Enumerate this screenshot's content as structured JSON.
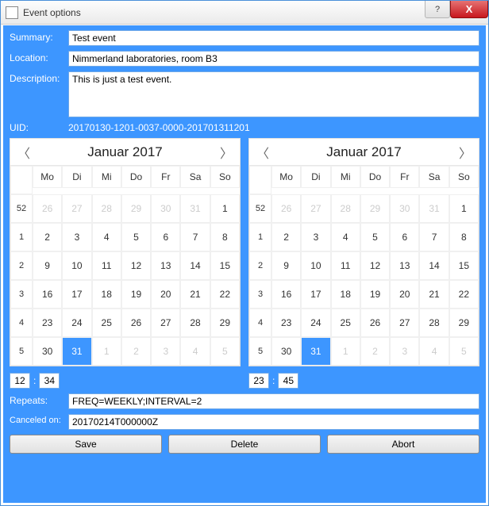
{
  "window": {
    "title": "Event options",
    "help": "?",
    "close": "X"
  },
  "form": {
    "summary_label": "Summary:",
    "summary_value": "Test event",
    "location_label": "Location:",
    "location_value": "Nimmerland laboratories, room B3",
    "description_label": "Description:",
    "description_value": "This is just a test event.",
    "uid_label": "UID:",
    "uid_value": "20170130-1201-0037-0000-201701311201",
    "repeats_label": "Repeats:",
    "repeats_value": "FREQ=WEEKLY;INTERVAL=2",
    "canceled_label": "Canceled on:",
    "canceled_value": "20170214T000000Z"
  },
  "calendar_left": {
    "title": "Januar 2017",
    "dow": [
      "Mo",
      "Di",
      "Mi",
      "Do",
      "Fr",
      "Sa",
      "So"
    ],
    "weeks": [
      {
        "wk": "52",
        "days": [
          {
            "d": "26",
            "other": true
          },
          {
            "d": "27",
            "other": true
          },
          {
            "d": "28",
            "other": true
          },
          {
            "d": "29",
            "other": true
          },
          {
            "d": "30",
            "other": true
          },
          {
            "d": "31",
            "other": true
          },
          {
            "d": "1"
          }
        ]
      },
      {
        "wk": "1",
        "days": [
          {
            "d": "2"
          },
          {
            "d": "3"
          },
          {
            "d": "4"
          },
          {
            "d": "5"
          },
          {
            "d": "6"
          },
          {
            "d": "7"
          },
          {
            "d": "8"
          }
        ]
      },
      {
        "wk": "2",
        "days": [
          {
            "d": "9"
          },
          {
            "d": "10"
          },
          {
            "d": "11"
          },
          {
            "d": "12"
          },
          {
            "d": "13"
          },
          {
            "d": "14"
          },
          {
            "d": "15"
          }
        ]
      },
      {
        "wk": "3",
        "days": [
          {
            "d": "16"
          },
          {
            "d": "17"
          },
          {
            "d": "18"
          },
          {
            "d": "19"
          },
          {
            "d": "20"
          },
          {
            "d": "21"
          },
          {
            "d": "22"
          }
        ]
      },
      {
        "wk": "4",
        "days": [
          {
            "d": "23"
          },
          {
            "d": "24"
          },
          {
            "d": "25"
          },
          {
            "d": "26"
          },
          {
            "d": "27"
          },
          {
            "d": "28"
          },
          {
            "d": "29"
          }
        ]
      },
      {
        "wk": "5",
        "days": [
          {
            "d": "30"
          },
          {
            "d": "31",
            "sel": true
          },
          {
            "d": "1",
            "other": true
          },
          {
            "d": "2",
            "other": true
          },
          {
            "d": "3",
            "other": true
          },
          {
            "d": "4",
            "other": true
          },
          {
            "d": "5",
            "other": true
          }
        ]
      }
    ]
  },
  "calendar_right": {
    "title": "Januar 2017",
    "dow": [
      "Mo",
      "Di",
      "Mi",
      "Do",
      "Fr",
      "Sa",
      "So"
    ],
    "weeks": [
      {
        "wk": "52",
        "days": [
          {
            "d": "26",
            "other": true
          },
          {
            "d": "27",
            "other": true
          },
          {
            "d": "28",
            "other": true
          },
          {
            "d": "29",
            "other": true
          },
          {
            "d": "30",
            "other": true
          },
          {
            "d": "31",
            "other": true
          },
          {
            "d": "1"
          }
        ]
      },
      {
        "wk": "1",
        "days": [
          {
            "d": "2"
          },
          {
            "d": "3"
          },
          {
            "d": "4"
          },
          {
            "d": "5"
          },
          {
            "d": "6"
          },
          {
            "d": "7"
          },
          {
            "d": "8"
          }
        ]
      },
      {
        "wk": "2",
        "days": [
          {
            "d": "9"
          },
          {
            "d": "10"
          },
          {
            "d": "11"
          },
          {
            "d": "12"
          },
          {
            "d": "13"
          },
          {
            "d": "14"
          },
          {
            "d": "15"
          }
        ]
      },
      {
        "wk": "3",
        "days": [
          {
            "d": "16"
          },
          {
            "d": "17"
          },
          {
            "d": "18"
          },
          {
            "d": "19"
          },
          {
            "d": "20"
          },
          {
            "d": "21"
          },
          {
            "d": "22"
          }
        ]
      },
      {
        "wk": "4",
        "days": [
          {
            "d": "23"
          },
          {
            "d": "24"
          },
          {
            "d": "25"
          },
          {
            "d": "26"
          },
          {
            "d": "27"
          },
          {
            "d": "28"
          },
          {
            "d": "29"
          }
        ]
      },
      {
        "wk": "5",
        "days": [
          {
            "d": "30"
          },
          {
            "d": "31",
            "sel": true
          },
          {
            "d": "1",
            "other": true
          },
          {
            "d": "2",
            "other": true
          },
          {
            "d": "3",
            "other": true
          },
          {
            "d": "4",
            "other": true
          },
          {
            "d": "5",
            "other": true
          }
        ]
      }
    ]
  },
  "time_left": {
    "h": "12",
    "m": "34"
  },
  "time_right": {
    "h": "23",
    "m": "45"
  },
  "buttons": {
    "save": "Save",
    "delete": "Delete",
    "abort": "Abort"
  },
  "glyphs": {
    "prev": "〈",
    "next": "〉",
    "colon": ":"
  }
}
